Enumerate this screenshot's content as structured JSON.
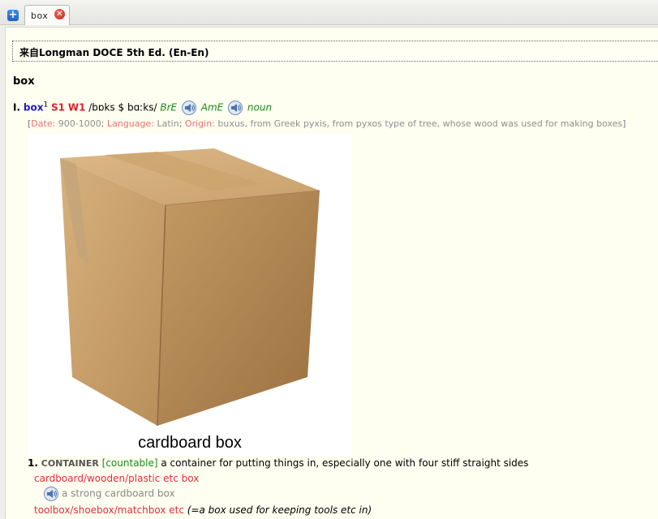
{
  "tabbar": {
    "add_icon": "plus-icon",
    "tab_label": "box",
    "close_icon": "close-icon"
  },
  "dictionary": {
    "source": "来自Longman DOCE 5th Ed. (En-En)",
    "headword": "box",
    "entry": {
      "roman": "I.",
      "hw": "box",
      "superscript": "1",
      "s1": "S1",
      "w1": "W1",
      "pron": "/bɒks $ bɑːks/",
      "bre": "BrE",
      "ame": "AmE",
      "pos": "noun"
    },
    "etymology": {
      "open": "[",
      "date_key": "Date:",
      "date_val": "900-1000",
      "sep1": ";",
      "lang_key": "Language:",
      "lang_val": "Latin",
      "sep2": ";",
      "origin_key": "Origin:",
      "origin_val": "buxus, from Greek pyxis, from pyxos type of tree, whose wood was used for making boxes",
      "close": "]"
    },
    "image_caption": "cardboard box",
    "sense": {
      "num": "1.",
      "signpost": "CONTAINER",
      "gram": "[countable]",
      "def": "a container for putting things in, especially one with four stiff straight sides"
    },
    "collocation1": "cardboard/wooden/plastic etc box",
    "example1": "a strong cardboard box",
    "collocation2": "toolbox/shoebox/matchbox etc",
    "collocation2_gloss": "(=a box used for keeping tools etc in)"
  }
}
